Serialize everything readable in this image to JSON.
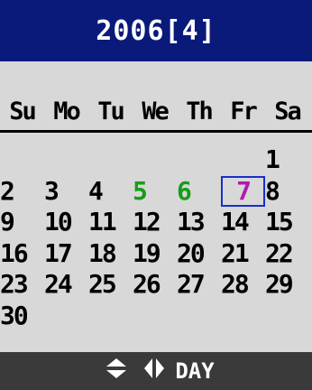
{
  "header": {
    "title": "2006[4]"
  },
  "weekdays": [
    "Su",
    "Mo",
    "Tu",
    "We",
    "Th",
    "Fr",
    "Sa"
  ],
  "weeks": [
    [
      "",
      "",
      "",
      "",
      "",
      "",
      "1"
    ],
    [
      "2",
      "3",
      "4",
      "5",
      "6",
      "7",
      "8"
    ],
    [
      "9",
      "10",
      "11",
      "12",
      "13",
      "14",
      "15"
    ],
    [
      "16",
      "17",
      "18",
      "19",
      "20",
      "21",
      "22"
    ],
    [
      "23",
      "24",
      "25",
      "26",
      "27",
      "28",
      "29"
    ],
    [
      "30",
      "",
      "",
      "",
      "",
      "",
      ""
    ]
  ],
  "highlighted_days": [
    "5",
    "6"
  ],
  "selected_day": "7",
  "colors": {
    "title_bg": "#0a1a7a",
    "holiday": "#179c17",
    "selected_text": "#b01ab0",
    "selected_box": "#1a2ec8",
    "footer_bg": "#3a3a3a"
  },
  "footer": {
    "updown_icon": "up-down-arrows-icon",
    "leftright_icon": "left-right-arrows-icon",
    "mode_label": "DAY"
  }
}
